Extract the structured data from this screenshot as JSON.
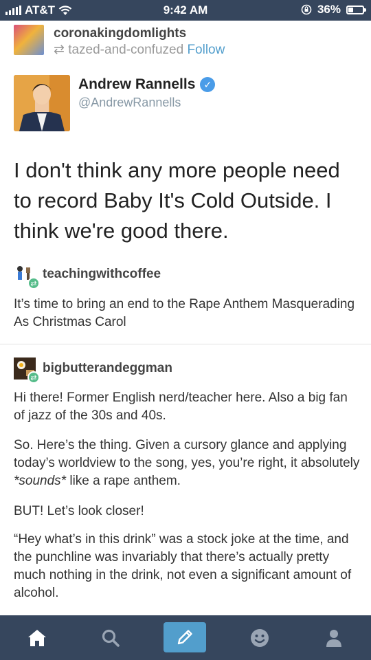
{
  "status_bar": {
    "carrier": "AT&T",
    "time": "9:42 AM",
    "battery": "36%",
    "battery_level": 0.36
  },
  "post": {
    "blog_name": "coronakingdomlights",
    "reblogged_from": "tazed-and-confuzed",
    "follow_label": "Follow"
  },
  "tweet": {
    "display_name": "Andrew Rannells",
    "handle": "@AndrewRannells",
    "text": "I don't think any more people need to record Baby It's Cold Outside. I think we're good there."
  },
  "reblogs": [
    {
      "username": "teachingwithcoffee",
      "paragraphs": [
        "It’s time to bring an end to the Rape Anthem Masquerading As Christmas Carol"
      ]
    },
    {
      "username": "bigbutterandeggman",
      "paragraphs": [
        "Hi there! Former English nerd/teacher here. Also a big fan of jazz of the 30s and 40s.",
        "So. Here’s the thing. Given a cursory glance and applying today’s worldview to the song, yes, you’re right, it absolutely ",
        "*sounds*",
        " like a rape anthem.",
        "BUT! Let’s look closer!",
        "“Hey what’s in this drink” was a stock joke at the time, and the punchline was invariably that there’s actually pretty much nothing in the drink, not even a significant amount of alcohol."
      ]
    }
  ],
  "nav": {
    "icons": [
      "home-icon",
      "search-icon",
      "compose-icon",
      "activity-icon",
      "account-icon"
    ],
    "active_color": "#ffffff",
    "compose_color": "#529ecc",
    "bar_color": "#36465d"
  }
}
